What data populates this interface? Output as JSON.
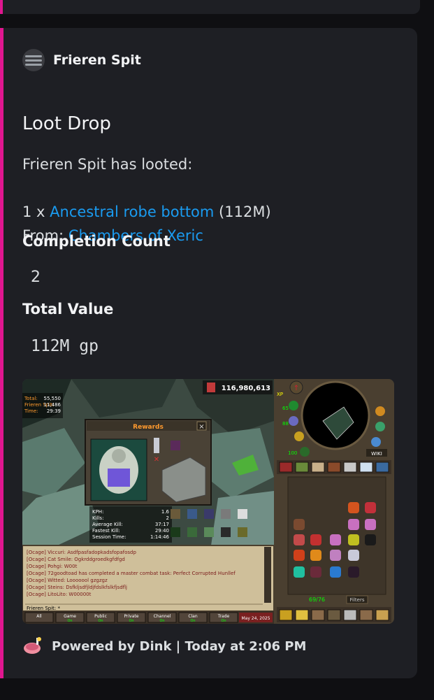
{
  "embed": {
    "accent_color": "#e0168f",
    "author": {
      "name": "Frieren Spit"
    },
    "title": "Loot Drop",
    "description": {
      "line1": "Frieren Spit has looted:",
      "item_qty": "1 x ",
      "item_name": "Ancestral robe bottom",
      "item_value": " (112M)",
      "from_label": "From: ",
      "from_source": "Chambers of Xeric"
    },
    "fields": [
      {
        "name": "Completion Count",
        "value": "2"
      },
      {
        "name": "Total Value",
        "value": "112M gp"
      }
    ],
    "footer": {
      "text": "Powered by Dink | Today at 2:06 PM"
    }
  },
  "game": {
    "coins": "116,980,613",
    "overlay": {
      "total_label": "Total:",
      "total_value": "55,550",
      "player_label": "Frieren Spit:",
      "player_value": "11,486",
      "time_label": "Time:",
      "time_value": "29:39"
    },
    "rewards_title": "Rewards",
    "raid_stats": [
      {
        "label": "KPH:",
        "value": "1.6"
      },
      {
        "label": "Kills:",
        "value": "2"
      },
      {
        "label": "Average Kill:",
        "value": "37:17"
      },
      {
        "label": "Fastest Kill:",
        "value": "29:40"
      },
      {
        "label": "Session Time:",
        "value": "1:14:46"
      }
    ],
    "chat": [
      "[Ocage] Viccuri: Asdfpasfadopkadsfopafosdp",
      "[Ocage] Cat Smile: Ogkrddgroedkgfdfgd",
      "[Ocage] Pohgi: W00t",
      "[Ocage] 72goodtoad has completed a master combat task: Perfect Corrupted Hunllef",
      "[Ocage] Witted: Looooool gzgzgz",
      "[Ocage] Steins: Dsfkljsdfjldjfdslkfslkfjsdflj",
      "[Ocage] LitoLito: W00000t"
    ],
    "chat_input": "Frieren Spit: *",
    "chat_tabs": [
      "All",
      "Game",
      "Public",
      "Private",
      "Channel",
      "Clan",
      "Trade"
    ],
    "chat_tab_state": [
      "",
      "On",
      "On",
      "On",
      "On",
      "On",
      "On"
    ],
    "date": "May 24, 2025",
    "stat_orbs": [
      "65",
      "88",
      "100"
    ],
    "inv_count": "69/76",
    "filters_label": "Filters",
    "wiki_label": "WIKI",
    "xp_label": "XP"
  }
}
